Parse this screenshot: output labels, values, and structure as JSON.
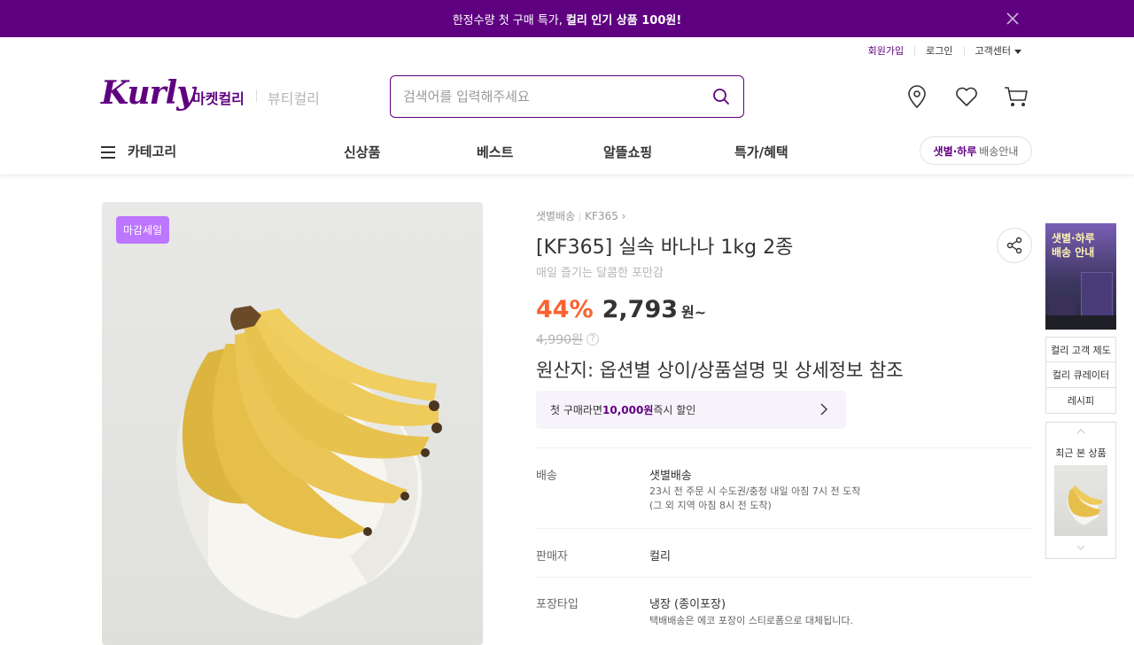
{
  "banner": {
    "text": "한정수량 첫 구매 특가,",
    "bold": "컬리 인기 상품 100원!"
  },
  "util": {
    "signup": "회원가입",
    "login": "로그인",
    "cs": "고객센터"
  },
  "header": {
    "logo": "Kurly",
    "market": "마켓컬리",
    "beauty": "뷰티컬리",
    "search_placeholder": "검색어를 입력해주세요"
  },
  "gnb": {
    "category": "카테고리",
    "menu": [
      "신상품",
      "베스트",
      "알뜰쇼핑",
      "특가/혜택"
    ],
    "delivery_bold": "샛별·하루",
    "delivery_rest": "배송안내"
  },
  "product": {
    "tag": "마감세일",
    "crumb1": "샛별배송",
    "crumb2": "KF365",
    "title": "[KF365] 실속 바나나 1kg 2종",
    "subtitle": "매일 즐기는 달콤한 포만감",
    "discount": "44%",
    "price": "2,793",
    "unit": "원~",
    "original": "4,990원",
    "origin": "원산지: 옵션별 상이/상품설명 및 상세정보 참조",
    "coupon_pre": "첫 구매라면 ",
    "coupon_amount": "10,000원",
    "coupon_post": " 즉시 할인"
  },
  "info": {
    "delivery_label": "배송",
    "delivery_value": "샛별배송",
    "delivery_desc1": "23시 전 주문 시 수도권/충청 내일 아침 7시 전 도착",
    "delivery_desc2": "(그 외 지역 아침 8시 전 도착)",
    "seller_label": "판매자",
    "seller_value": "컬리",
    "package_label": "포장타입",
    "package_value": "냉장 (종이포장)",
    "package_desc": "택배배송은 에코 포장이 스티로폼으로 대체됩니다."
  },
  "side": {
    "banner_line1": "샛별·하루",
    "banner_line2": "배송 안내",
    "links": [
      "컬리 고객 제도",
      "컬리 큐레이터",
      "레시피"
    ],
    "recent": "최근 본 상품"
  },
  "colors": {
    "brand": "#5f0080",
    "discount": "#fa622f",
    "tag": "#bd76ff"
  }
}
